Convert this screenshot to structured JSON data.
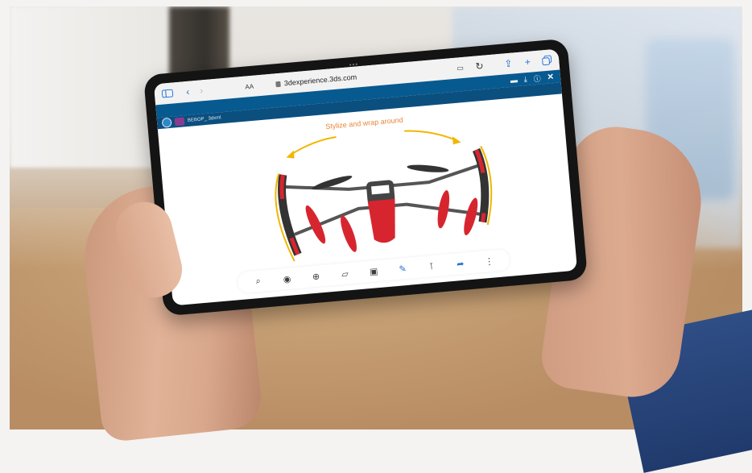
{
  "browser": {
    "text_size_label": "AA",
    "url": "3dexperience.3ds.com"
  },
  "app": {
    "document_tab": "BEBOP_ 3dxml"
  },
  "viewport": {
    "annotation": "Stylize and wrap around"
  },
  "icons": {
    "sidebar": "sidebar-icon",
    "back": "back-icon",
    "forward": "forward-icon",
    "reader": "reader-icon",
    "reload": "reload-icon",
    "share": "share-icon",
    "new_tab": "plus-icon",
    "tabs": "tabs-icon",
    "comment": "comment-icon",
    "download": "download-icon",
    "info": "info-icon",
    "close": "close-icon",
    "toolbar": [
      "zoom-fit-icon",
      "eye-icon",
      "zoom-area-icon",
      "cube-view-icon",
      "section-icon",
      "pencil-icon",
      "measure-icon",
      "share-arrow-icon",
      "more-icon"
    ]
  },
  "colors": {
    "app_header": "#075a90",
    "annotation": "#e8843a",
    "drone_red": "#d7252f",
    "wrap_yellow": "#f2b600"
  }
}
